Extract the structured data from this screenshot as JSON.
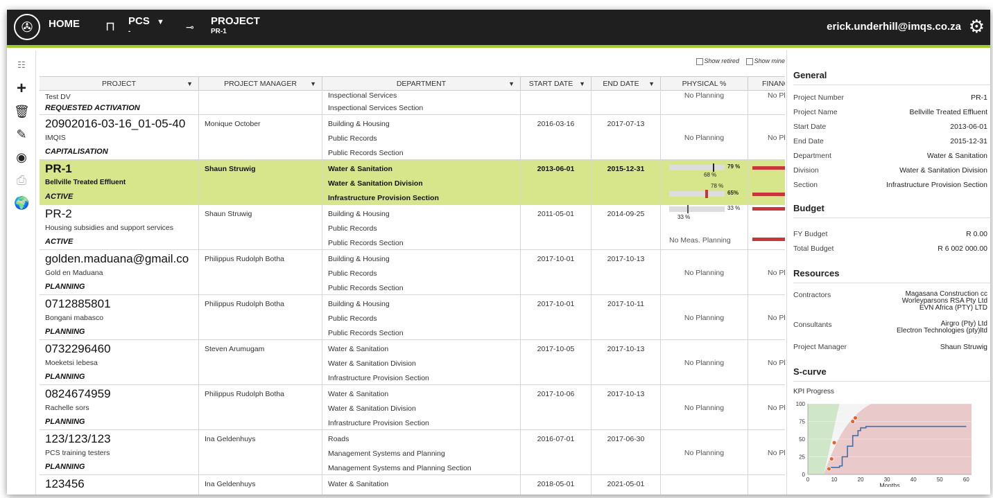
{
  "topbar": {
    "home": "HOME",
    "pcs": "PCS",
    "pcs_sub": "-",
    "pcs_caret": "▼",
    "project": "PROJECT",
    "project_sub": "PR-1",
    "user": "erick.underhill@imqs.co.za"
  },
  "toggles": {
    "show_retired": "Show retired",
    "show_mine": "Show mine"
  },
  "columns": [
    "PROJECT",
    "PROJECT MANAGER",
    "DEPARTMENT",
    "START DATE",
    "END DATE",
    "PHYSICAL %",
    "FINANCIA"
  ],
  "partial_row": {
    "name": "Test DV",
    "status": "REQUESTED ACTIVATION",
    "dept": [
      "Inspectional Services",
      "Inspectional Services Section"
    ],
    "physical": "No Planning",
    "financial": "No Plar"
  },
  "rows": [
    {
      "code": "20902016-03-16_01-05-40",
      "name": "IMQIS",
      "status": "CAPITALISATION",
      "manager": "Monique October",
      "dept": [
        "Building & Housing",
        "Public Records",
        "Public Records Section"
      ],
      "start": "2016-03-16",
      "end": "2017-07-13",
      "physical": "No Planning",
      "financial": "No Plar"
    },
    {
      "code": "PR-1",
      "name": "Bellville Treated Effluent",
      "status": "ACTIVE",
      "manager": "Shaun Struwig",
      "dept": [
        "Water & Sanitation",
        "Water & Sanitation Division",
        "Infrastructure Provision Section"
      ],
      "start": "2013-06-01",
      "end": "2015-12-31",
      "physical": "",
      "financial": ""
    },
    {
      "code": "PR-2",
      "name": "Housing subsidies and support services",
      "status": "ACTIVE",
      "manager": "Shaun Struwig",
      "dept": [
        "Building & Housing",
        "Public Records",
        "Public Records Section"
      ],
      "start": "2011-05-01",
      "end": "2014-09-25",
      "physical": "No Meas. Planning",
      "financial": ""
    },
    {
      "code": "golden.maduana@gmail.co",
      "name": "Gold en Maduana",
      "status": "PLANNING",
      "manager": "Philippus Rudolph Botha",
      "dept": [
        "Building & Housing",
        "Public Records",
        "Public Records Section"
      ],
      "start": "2017-10-01",
      "end": "2017-10-13",
      "physical": "No Planning",
      "financial": "No Plar"
    },
    {
      "code": "0712885801",
      "name": "Bongani mabasco",
      "status": "PLANNING",
      "manager": "Philippus Rudolph Botha",
      "dept": [
        "Building & Housing",
        "Public Records",
        "Public Records Section"
      ],
      "start": "2017-10-01",
      "end": "2017-10-11",
      "physical": "No Planning",
      "financial": "No Plar"
    },
    {
      "code": "0732296460",
      "name": "Moeketsi lebesa",
      "status": "PLANNING",
      "manager": "Steven Arumugam",
      "dept": [
        "Water & Sanitation",
        "Water & Sanitation Division",
        "Infrastructure Provision Section"
      ],
      "start": "2017-10-05",
      "end": "2017-10-13",
      "physical": "No Planning",
      "financial": "No Plar"
    },
    {
      "code": "0824674959",
      "name": "Rachelle sors",
      "status": "PLANNING",
      "manager": "Philippus Rudolph Botha",
      "dept": [
        "Water & Sanitation",
        "Water & Sanitation Division",
        "Infrastructure Provision Section"
      ],
      "start": "2017-10-06",
      "end": "2017-10-13",
      "physical": "No Planning",
      "financial": "No Plar"
    },
    {
      "code": "123/123/123",
      "name": "PCS training testers",
      "status": "PLANNING",
      "manager": "Ina Geldenhuys",
      "dept": [
        "Roads",
        "Management Systems and Planning",
        "Management Systems and Planning Section"
      ],
      "start": "2016-07-01",
      "end": "2017-06-30",
      "physical": "No Planning",
      "financial": "No Plar"
    },
    {
      "code": "123456",
      "name": "",
      "status": "",
      "manager": "Ina Geldenhuys",
      "dept": [
        "Water & Sanitation"
      ],
      "start": "2018-05-01",
      "end": "2021-05-01",
      "physical": "",
      "financial": ""
    }
  ],
  "pr1_bars": {
    "bar1_value": 79,
    "bar1_label": "79 %",
    "bar1_sub": "68 %",
    "bar2_top": "78 %",
    "bar2_value": 65,
    "bar2_label": "65%"
  },
  "pr2_bars": {
    "bar_value": 33,
    "bar_label": "33 %",
    "bar_sub": "33 %"
  },
  "panel": {
    "general": {
      "title": "General",
      "items": [
        {
          "label": "Project Number",
          "value": "PR-1"
        },
        {
          "label": "Project Name",
          "value": "Bellville Treated Effluent"
        },
        {
          "label": "Start Date",
          "value": "2013-06-01"
        },
        {
          "label": "End Date",
          "value": "2015-12-31"
        },
        {
          "label": "Department",
          "value": "Water & Sanitation"
        },
        {
          "label": "Division",
          "value": "Water & Sanitation Division"
        },
        {
          "label": "Section",
          "value": "Infrastructure Provision Section"
        }
      ]
    },
    "budget": {
      "title": "Budget",
      "items": [
        {
          "label": "FY Budget",
          "value": "R 0.00"
        },
        {
          "label": "Total Budget",
          "value": "R 6 002 000.00"
        }
      ]
    },
    "resources": {
      "title": "Resources",
      "contractors_label": "Contractors",
      "contractors": [
        "Magasana Construction cc",
        "Worleyparsons RSA Pty Ltd",
        "EVN Africa (PTY) LTD"
      ],
      "consultants_label": "Consultants",
      "consultants": [
        "Airgro (Pty) Ltd",
        "Electron Technologies (pty)ltd"
      ],
      "manager_label": "Project Manager",
      "manager": "Shaun Struwig"
    },
    "scurve": {
      "title": "S-curve",
      "subtitle": "KPI Progress"
    }
  },
  "chart_data": {
    "type": "line",
    "title": "KPI Progress",
    "xlabel": "Months",
    "ylabel": "",
    "xlim": [
      0,
      62
    ],
    "ylim": [
      0,
      100
    ],
    "xticks": [
      0,
      10,
      20,
      30,
      40,
      50,
      60
    ],
    "yticks": [
      0,
      25,
      50,
      75,
      100
    ],
    "series": [
      {
        "name": "",
        "x": [
          8,
          12,
          13,
          15,
          17,
          19,
          20,
          22,
          60
        ],
        "y": [
          10,
          12,
          25,
          40,
          55,
          62,
          66,
          68,
          68
        ]
      }
    ],
    "points": {
      "x": [
        8,
        9,
        10,
        17,
        18
      ],
      "y": [
        8,
        22,
        45,
        75,
        80
      ]
    }
  }
}
